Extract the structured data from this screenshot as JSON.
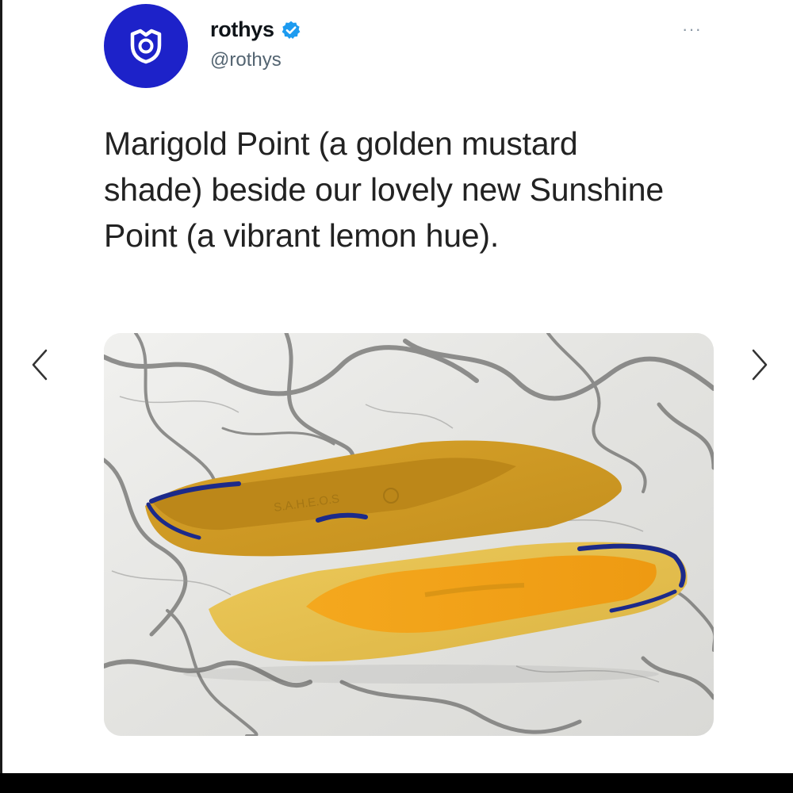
{
  "tweet": {
    "display_name": "rothys",
    "handle": "@rothys",
    "verified": true,
    "text": "Marigold Point (a golden mustard shade) beside our lovely new Sunshine Point (a vibrant lemon hue).",
    "more_label": "···"
  },
  "icons": {
    "avatar": "rothys-logo-icon",
    "verified": "verified-badge-icon",
    "prev": "chevron-left-icon",
    "next": "chevron-right-icon"
  },
  "colors": {
    "avatar_bg": "#1d22c9",
    "verified": "#1d9bf0",
    "marigold_shoe": "#d9a62e",
    "sunshine_shoe": "#e7c353",
    "insole_orange": "#f0a21c",
    "heel_trim_navy": "#1c2a8a"
  }
}
